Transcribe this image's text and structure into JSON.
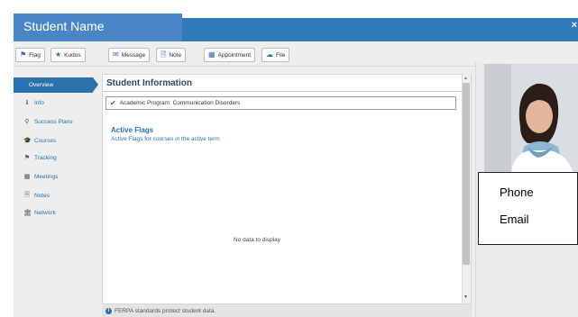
{
  "header": {
    "student_name": "Student Name",
    "close": "×"
  },
  "toolbar": {
    "buttons": [
      {
        "label": "Flag",
        "icon": "flag-icon"
      },
      {
        "label": "Kudos",
        "icon": "star-icon"
      },
      {
        "label": "Message",
        "icon": "envelope-icon"
      },
      {
        "label": "Note",
        "icon": "note-icon"
      },
      {
        "label": "Appointment",
        "icon": "calendar-icon"
      },
      {
        "label": "File",
        "icon": "cloud-upload-icon"
      }
    ]
  },
  "sidebar": {
    "items": [
      {
        "label": "Overview",
        "icon": "user-icon",
        "active": true
      },
      {
        "label": "Info",
        "icon": "info-icon"
      },
      {
        "label": "Success Plans",
        "icon": "sitemap-icon"
      },
      {
        "label": "Courses",
        "icon": "graduation-cap-icon"
      },
      {
        "label": "Tracking",
        "icon": "flag-icon"
      },
      {
        "label": "Meetings",
        "icon": "calendar-icon"
      },
      {
        "label": "Notes",
        "icon": "notes-icon"
      },
      {
        "label": "Network",
        "icon": "building-icon"
      }
    ]
  },
  "main": {
    "title": "Student Information",
    "academic_program": "Academic Program: Communication Disorders",
    "active_flags": {
      "title": "Active Flags",
      "subtitle": "Active Flags for courses in the active term",
      "empty": "No data to display"
    },
    "footer": "FERPA standards protect student data."
  },
  "contact": {
    "phone": "Phone",
    "email": "Email"
  },
  "colors": {
    "accent": "#2c70ac",
    "titlebar": "#2f7ab8",
    "name_tab": "#4a86c5"
  }
}
